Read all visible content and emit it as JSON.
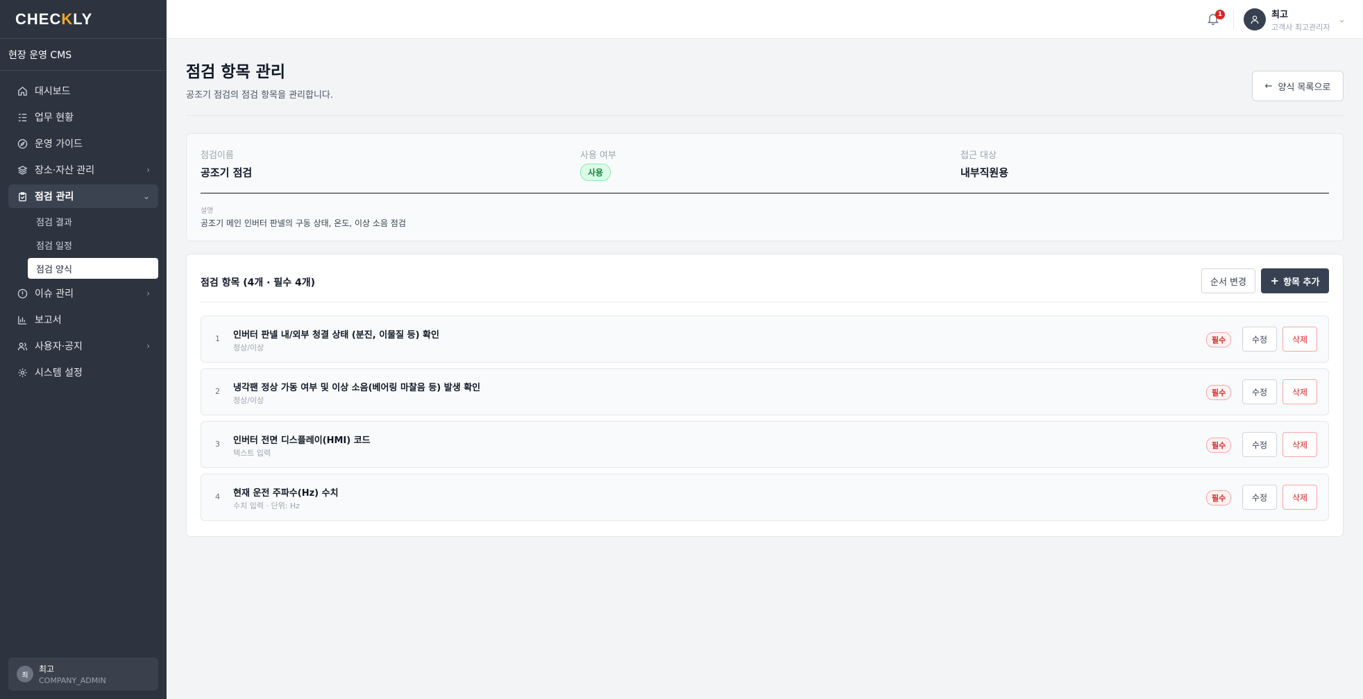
{
  "brand": {
    "logo_a": "CHEC",
    "logo_accent": "K",
    "logo_b": "LY",
    "accent_color": "#f5a524"
  },
  "sidebar": {
    "cms_title": "현장 운영 CMS",
    "items": [
      {
        "label": "대시보드",
        "icon": "home-icon"
      },
      {
        "label": "업무 현황",
        "icon": "task-list-icon"
      },
      {
        "label": "운영 가이드",
        "icon": "compass-icon"
      },
      {
        "label": "장소·자산 관리",
        "icon": "layers-icon"
      },
      {
        "label": "점검 관리",
        "icon": "clipboard-check-icon"
      },
      {
        "label": "이슈 관리",
        "icon": "alert-circle-icon"
      },
      {
        "label": "보고서",
        "icon": "bar-chart-icon"
      },
      {
        "label": "사용자·공지",
        "icon": "users-icon"
      },
      {
        "label": "시스템 설정",
        "icon": "gear-icon"
      }
    ],
    "sub_items": [
      {
        "label": "점검 결과"
      },
      {
        "label": "점검 일정"
      },
      {
        "label": "점검 양식"
      }
    ],
    "user": {
      "avatar": "최",
      "name": "최고",
      "role": "COMPANY_ADMIN"
    }
  },
  "topbar": {
    "notification_count": "1",
    "user_name": "최고",
    "user_role": "고객사 최고관리자"
  },
  "page": {
    "title": "점검 항목 관리",
    "subtitle": "공조기 점검의 점검 항목을 관리합니다.",
    "back_label": "양식 목록으로"
  },
  "info": {
    "name_label": "점검이름",
    "name_value": "공조기 점검",
    "use_label": "사용 여부",
    "use_value": "사용",
    "access_label": "접근 대상",
    "access_value": "내부직원용",
    "desc_label": "설명",
    "desc_value": "공조기 메인 인버터 판넬의 구동 상태, 온도, 이상 소음 점검"
  },
  "items_section": {
    "title": "점검 항목 (4개 · 필수 4개)",
    "order_button": "순서 변경",
    "add_button": "항목 추가",
    "required_label": "필수",
    "edit_label": "수정",
    "delete_label": "삭제",
    "rows": [
      {
        "num": "1",
        "title": "인버터 판넬 내/외부 청결 상태 (분진, 이물질 등) 확인",
        "sub": "정상/이상"
      },
      {
        "num": "2",
        "title": "냉각팬 정상 가동 여부 및 이상 소음(베어링 마찰음 등) 발생 확인",
        "sub": "정상/이상"
      },
      {
        "num": "3",
        "title": "인버터 전면 디스플레이(HMI) 코드",
        "sub": "텍스트 입력"
      },
      {
        "num": "4",
        "title": "현재 운전 주파수(Hz) 수치",
        "sub": "수치 입력 · 단위: Hz"
      }
    ]
  }
}
